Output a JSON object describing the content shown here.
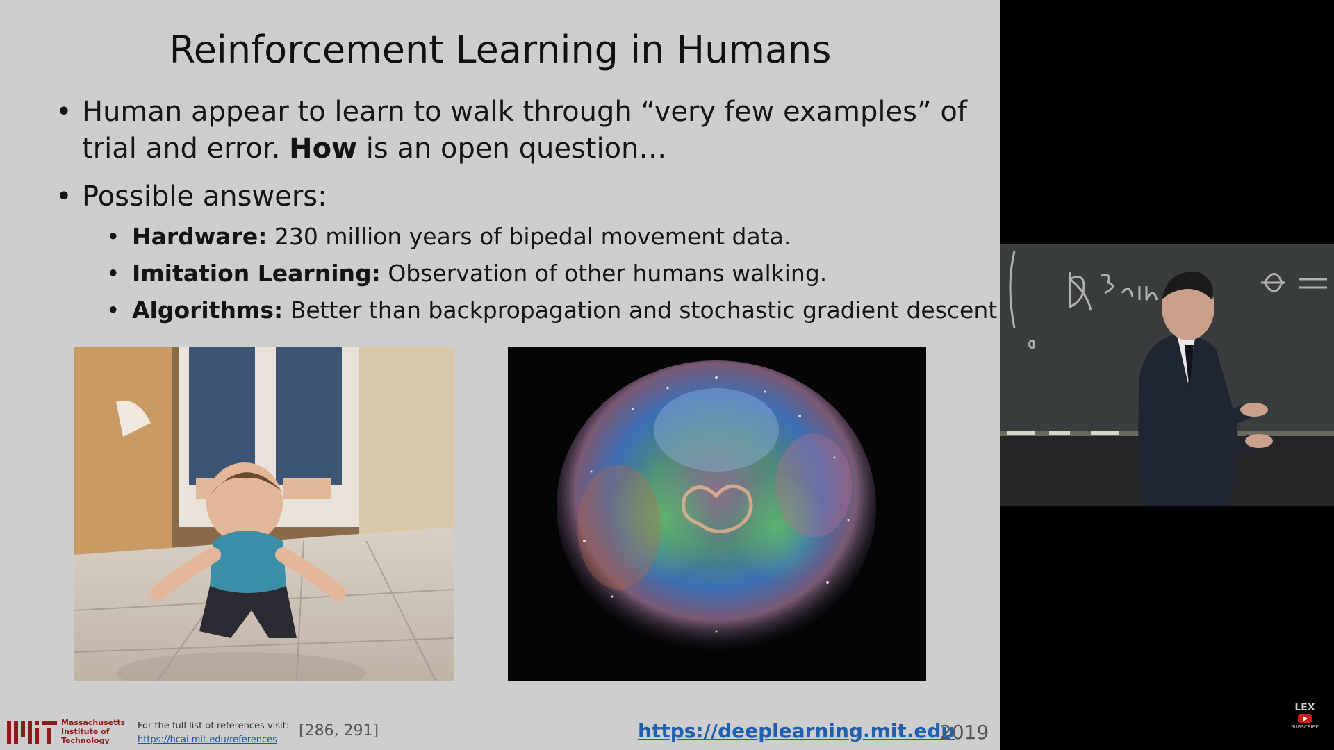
{
  "slide": {
    "title": "Reinforcement Learning in Humans",
    "bullets": [
      {
        "line1": "Human appear to learn to walk through “very few examples” of",
        "line2_prefix": "trial and error. ",
        "line2_bold": "How",
        "line2_suffix": " is an open question…"
      },
      {
        "text": "Possible answers:"
      }
    ],
    "answers": [
      {
        "label": "Hardware:",
        "text": " 230 million years of bipedal movement data."
      },
      {
        "label": "Imitation Learning:",
        "text": " Observation of other humans walking."
      },
      {
        "label": "Algorithms:",
        "text": " Better than backpropagation and stochastic gradient descent"
      }
    ],
    "bullet_char": "•"
  },
  "footer": {
    "institution": [
      "Massachusetts",
      "Institute of",
      "Technology"
    ],
    "references_label": "For the full list of references visit:",
    "references_link": "https://hcai.mit.edu/references",
    "reference_numbers": "[286, 291]",
    "site": "https://deeplearning.mit.edu",
    "year": "2019"
  },
  "channel_badge": {
    "name": "LEX",
    "subscribe": "SUBSCRIBE"
  },
  "colors": {
    "slide_bg": "#cdcdcd",
    "mit_red": "#8a1c1c",
    "link_blue": "#1f5fae",
    "subscribe_red": "#c91b1b"
  }
}
